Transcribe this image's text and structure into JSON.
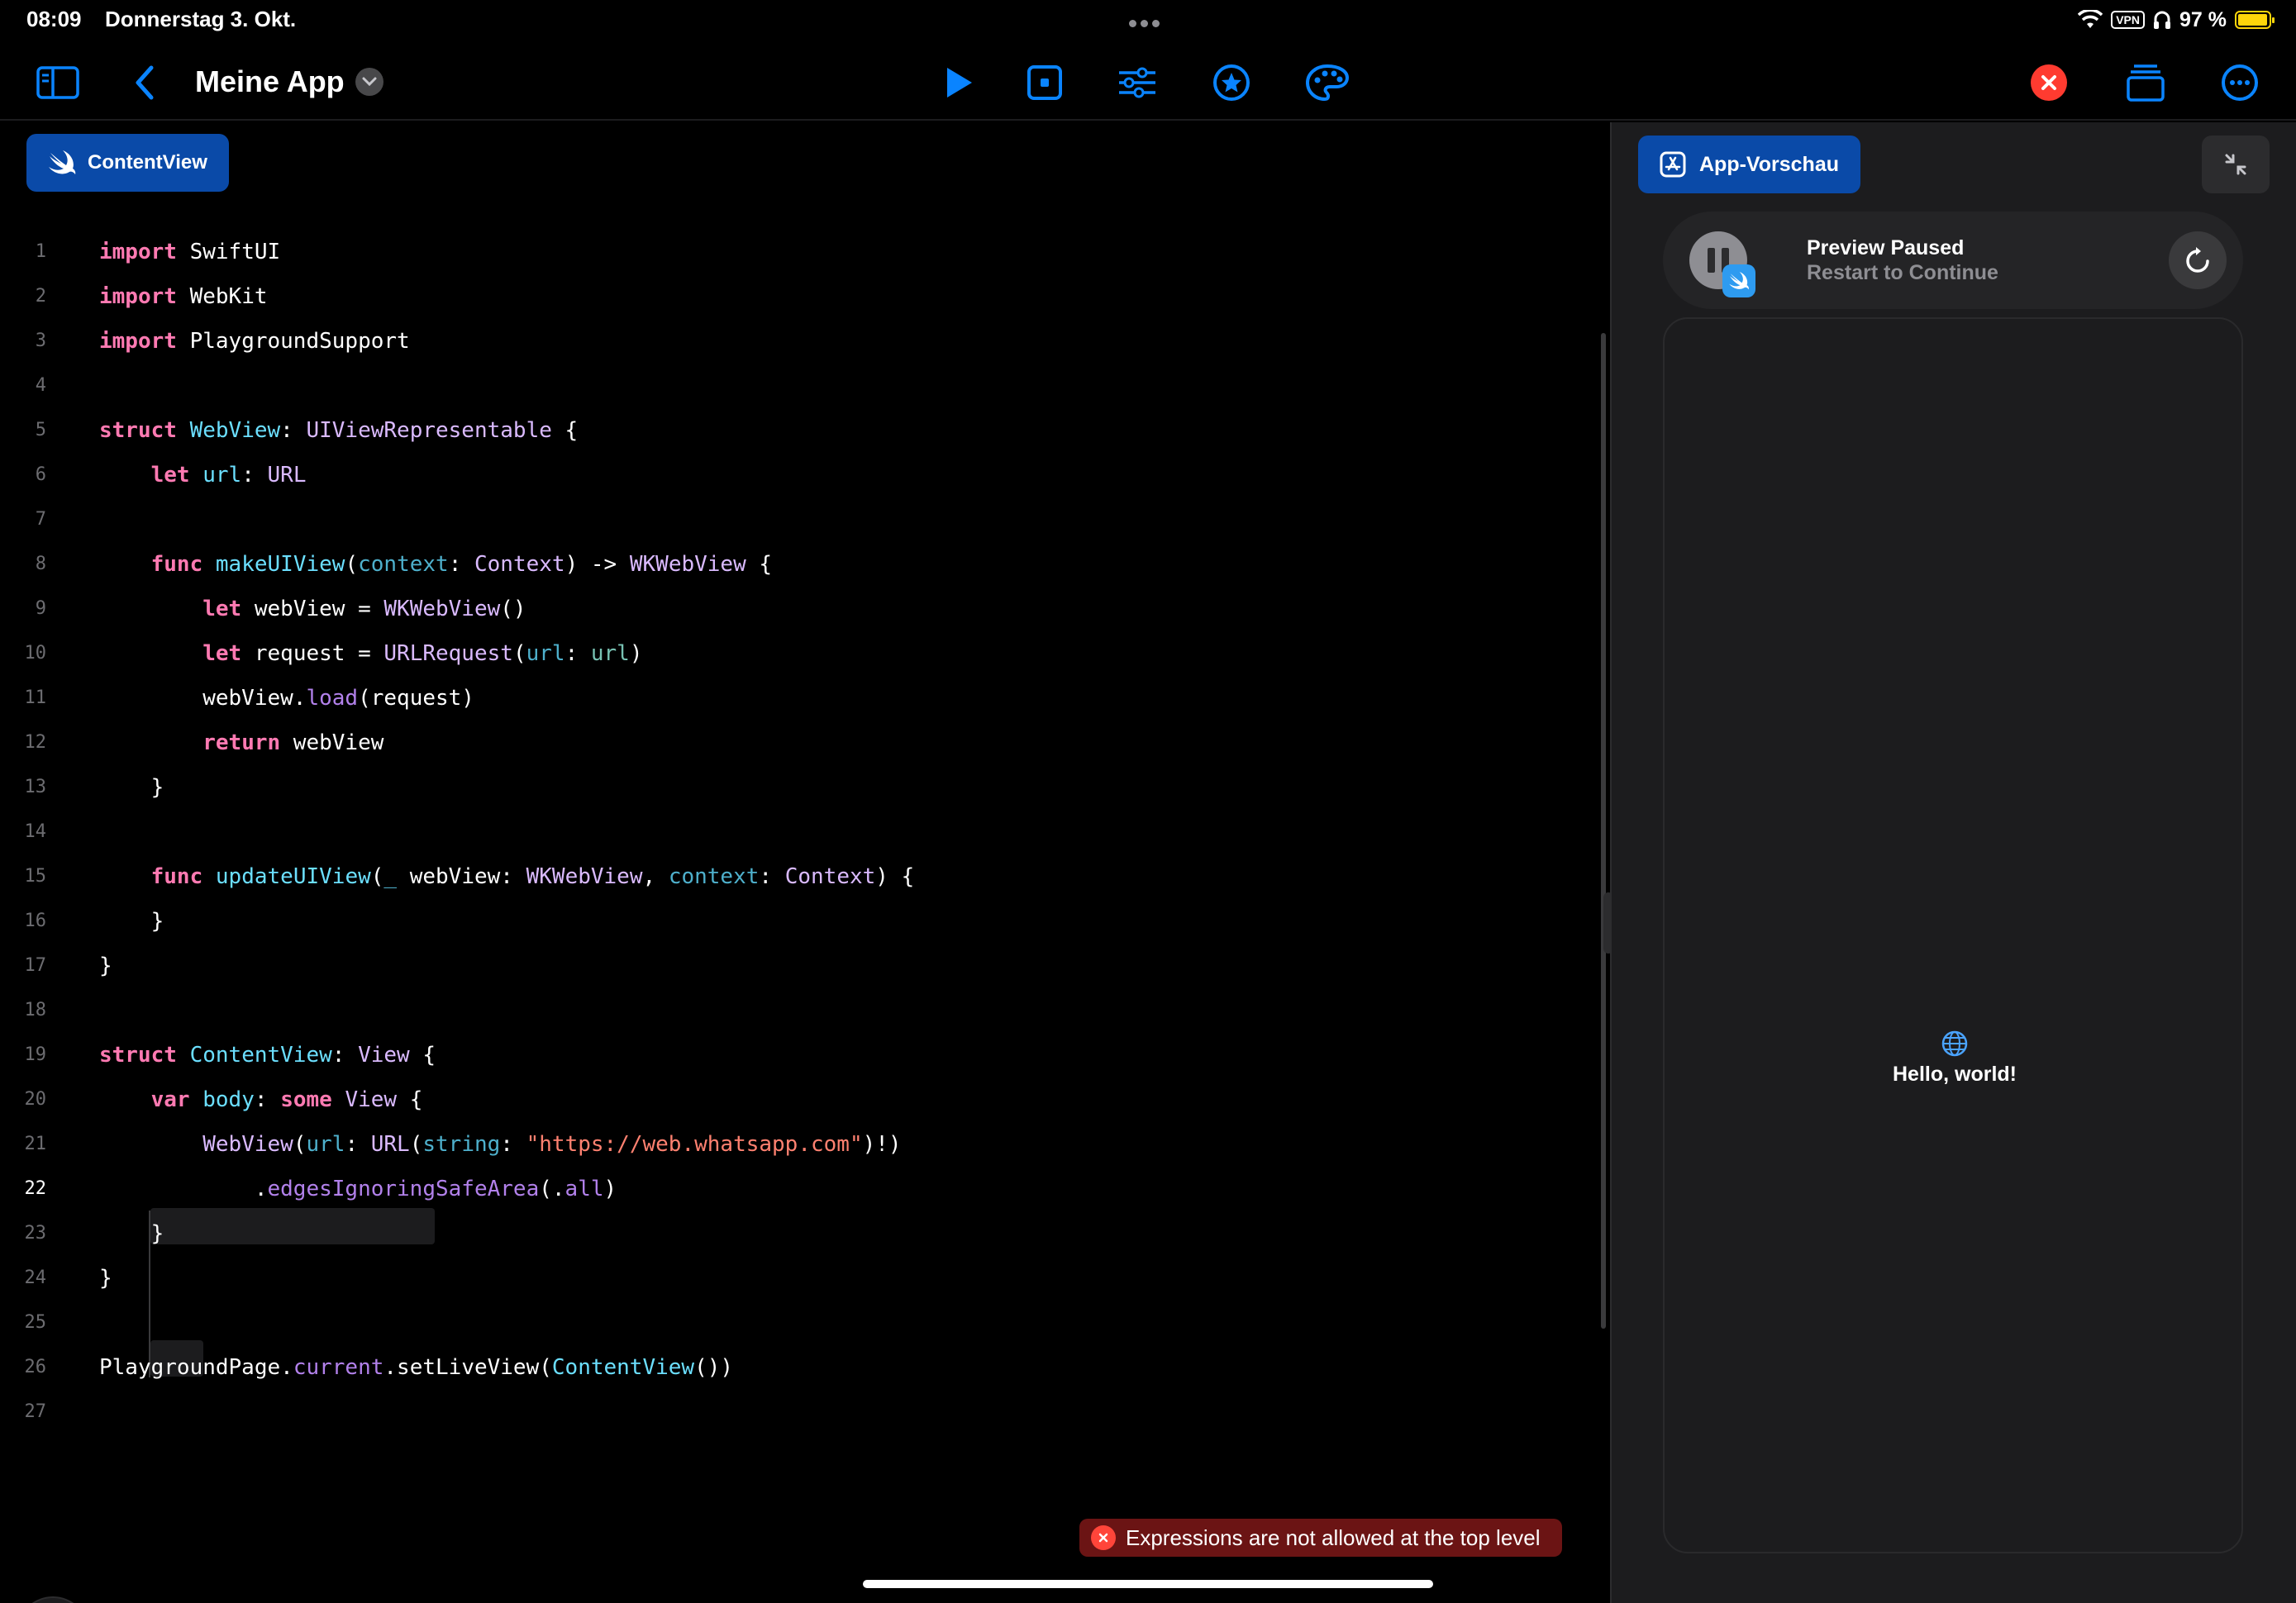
{
  "status_bar": {
    "time": "08:09",
    "date": "Donnerstag 3. Okt.",
    "vpn_label": "VPN",
    "battery": "97 %",
    "battery_level": 0.97
  },
  "toolbar": {
    "app_title": "Meine App",
    "icons": [
      "sidebar-icon",
      "back-chevron-icon",
      "play-icon",
      "stop-icon",
      "sliders-icon",
      "star-icon",
      "palette-icon",
      "close-icon",
      "stack-icon",
      "more-icon"
    ],
    "accent_color": "#0a84ff",
    "close_color": "#ff3b30"
  },
  "editor": {
    "file_tab": "ContentView",
    "error_message": "Expressions are not allowed at the top level",
    "active_line": 22,
    "lines": [
      {
        "n": "1",
        "tokens": [
          [
            "kw",
            "import"
          ],
          [
            "pl",
            " SwiftUI"
          ]
        ]
      },
      {
        "n": "2",
        "tokens": [
          [
            "kw",
            "import"
          ],
          [
            "pl",
            " WebKit"
          ]
        ]
      },
      {
        "n": "3",
        "tokens": [
          [
            "kw",
            "import"
          ],
          [
            "pl",
            " PlaygroundSupport"
          ]
        ]
      },
      {
        "n": "4",
        "tokens": []
      },
      {
        "n": "5",
        "tokens": [
          [
            "kw",
            "struct"
          ],
          [
            "pl",
            " "
          ],
          [
            "decl",
            "WebView"
          ],
          [
            "pl",
            ": "
          ],
          [
            "ty",
            "UIViewRepresentable"
          ],
          [
            "pl",
            " {"
          ]
        ]
      },
      {
        "n": "6",
        "tokens": [
          [
            "pl",
            "    "
          ],
          [
            "kw",
            "let"
          ],
          [
            "pl",
            " "
          ],
          [
            "decl",
            "url"
          ],
          [
            "pl",
            ": "
          ],
          [
            "ty",
            "URL"
          ]
        ]
      },
      {
        "n": "7",
        "tokens": []
      },
      {
        "n": "8",
        "tokens": [
          [
            "pl",
            "    "
          ],
          [
            "kw",
            "func"
          ],
          [
            "pl",
            " "
          ],
          [
            "decl",
            "makeUIView"
          ],
          [
            "pl",
            "("
          ],
          [
            "par",
            "context"
          ],
          [
            "pl",
            ": "
          ],
          [
            "ty",
            "Context"
          ],
          [
            "pl",
            ") -> "
          ],
          [
            "ty",
            "WKWebView"
          ],
          [
            "pl",
            " {"
          ]
        ]
      },
      {
        "n": "9",
        "tokens": [
          [
            "pl",
            "        "
          ],
          [
            "kw",
            "let"
          ],
          [
            "pl",
            " webView = "
          ],
          [
            "ty",
            "WKWebView"
          ],
          [
            "pl",
            "()"
          ]
        ]
      },
      {
        "n": "10",
        "tokens": [
          [
            "pl",
            "        "
          ],
          [
            "kw",
            "let"
          ],
          [
            "pl",
            " request = "
          ],
          [
            "ty",
            "URLRequest"
          ],
          [
            "pl",
            "("
          ],
          [
            "par",
            "url"
          ],
          [
            "pl",
            ": "
          ],
          [
            "id",
            "url"
          ],
          [
            "pl",
            ")"
          ]
        ]
      },
      {
        "n": "11",
        "tokens": [
          [
            "pl",
            "        webView."
          ],
          [
            "fn",
            "load"
          ],
          [
            "pl",
            "(request)"
          ]
        ]
      },
      {
        "n": "12",
        "tokens": [
          [
            "pl",
            "        "
          ],
          [
            "kw",
            "return"
          ],
          [
            "pl",
            " webView"
          ]
        ]
      },
      {
        "n": "13",
        "tokens": [
          [
            "pl",
            "    }"
          ]
        ]
      },
      {
        "n": "14",
        "tokens": []
      },
      {
        "n": "15",
        "tokens": [
          [
            "pl",
            "    "
          ],
          [
            "kw",
            "func"
          ],
          [
            "pl",
            " "
          ],
          [
            "decl",
            "updateUIView"
          ],
          [
            "pl",
            "("
          ],
          [
            "par",
            "_"
          ],
          [
            "pl",
            " webView: "
          ],
          [
            "ty",
            "WKWebView"
          ],
          [
            "pl",
            ", "
          ],
          [
            "par",
            "context"
          ],
          [
            "pl",
            ": "
          ],
          [
            "ty",
            "Context"
          ],
          [
            "pl",
            ") {"
          ]
        ]
      },
      {
        "n": "16",
        "tokens": [
          [
            "pl",
            "    }"
          ]
        ]
      },
      {
        "n": "17",
        "tokens": [
          [
            "pl",
            "}"
          ]
        ]
      },
      {
        "n": "18",
        "tokens": []
      },
      {
        "n": "19",
        "tokens": [
          [
            "kw",
            "struct"
          ],
          [
            "pl",
            " "
          ],
          [
            "decl",
            "ContentView"
          ],
          [
            "pl",
            ": "
          ],
          [
            "ty",
            "View"
          ],
          [
            "pl",
            " {"
          ]
        ]
      },
      {
        "n": "20",
        "tokens": [
          [
            "pl",
            "    "
          ],
          [
            "kw",
            "var"
          ],
          [
            "pl",
            " "
          ],
          [
            "decl",
            "body"
          ],
          [
            "pl",
            ": "
          ],
          [
            "kw",
            "some"
          ],
          [
            "pl",
            " "
          ],
          [
            "ty",
            "View"
          ],
          [
            "pl",
            " {"
          ]
        ]
      },
      {
        "n": "21",
        "tokens": [
          [
            "pl",
            "        "
          ],
          [
            "ty",
            "WebView"
          ],
          [
            "pl",
            "("
          ],
          [
            "par",
            "url"
          ],
          [
            "pl",
            ": "
          ],
          [
            "ty",
            "URL"
          ],
          [
            "pl",
            "("
          ],
          [
            "par",
            "string"
          ],
          [
            "pl",
            ": "
          ],
          [
            "str",
            "\"https://web.whatsapp.com\""
          ],
          [
            "pl",
            ")!)"
          ]
        ]
      },
      {
        "n": "22",
        "tokens": [
          [
            "pl",
            "            ."
          ],
          [
            "fn",
            "edgesIgnoringSafeArea"
          ],
          [
            "pl",
            "(."
          ],
          [
            "fn",
            "all"
          ],
          [
            "pl",
            ")"
          ]
        ]
      },
      {
        "n": "23",
        "tokens": [
          [
            "pl",
            "    }"
          ]
        ]
      },
      {
        "n": "24",
        "tokens": [
          [
            "pl",
            "}"
          ]
        ]
      },
      {
        "n": "25",
        "tokens": []
      },
      {
        "n": "26",
        "tokens": [
          [
            "pl",
            "PlaygroundPage."
          ],
          [
            "fn",
            "current"
          ],
          [
            "pl",
            "."
          ],
          [
            "pl",
            "setLiveView("
          ],
          [
            "decl",
            "ContentView"
          ],
          [
            "pl",
            "())"
          ]
        ]
      },
      {
        "n": "27",
        "tokens": []
      }
    ]
  },
  "preview": {
    "tab_label": "App-Vorschau",
    "status_title": "Preview Paused",
    "status_subtitle": "Restart to Continue",
    "content_text": "Hello, world!"
  }
}
